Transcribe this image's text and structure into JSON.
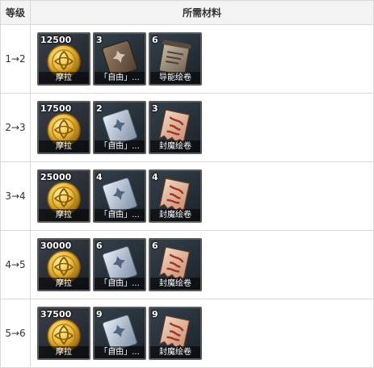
{
  "header": {
    "level": "等级",
    "materials": "所需材料"
  },
  "rows": [
    {
      "level": "1→2",
      "items": [
        {
          "icon": "mora-coin-icon",
          "qty": "12500",
          "name": "摩拉"
        },
        {
          "icon": "freedom-book-icon",
          "qty": "3",
          "name": "「自由」..."
        },
        {
          "icon": "guide-scroll-icon",
          "qty": "6",
          "name": "导能绘卷"
        }
      ]
    },
    {
      "level": "2→3",
      "items": [
        {
          "icon": "mora-coin-icon",
          "qty": "17500",
          "name": "摩拉"
        },
        {
          "icon": "freedom-book-icon",
          "qty": "2",
          "name": "「自由」..."
        },
        {
          "icon": "sealed-scroll-icon",
          "qty": "3",
          "name": "封魔绘卷"
        }
      ]
    },
    {
      "level": "3→4",
      "items": [
        {
          "icon": "mora-coin-icon",
          "qty": "25000",
          "name": "摩拉"
        },
        {
          "icon": "freedom-book-icon",
          "qty": "4",
          "name": "「自由」..."
        },
        {
          "icon": "sealed-scroll-icon",
          "qty": "4",
          "name": "封魔绘卷"
        }
      ]
    },
    {
      "level": "4→5",
      "items": [
        {
          "icon": "mora-coin-icon",
          "qty": "30000",
          "name": "摩拉"
        },
        {
          "icon": "freedom-book-icon",
          "qty": "6",
          "name": "「自由」..."
        },
        {
          "icon": "sealed-scroll-icon",
          "qty": "6",
          "name": "封魔绘卷"
        }
      ]
    },
    {
      "level": "5→6",
      "items": [
        {
          "icon": "mora-coin-icon",
          "qty": "37500",
          "name": "摩拉"
        },
        {
          "icon": "freedom-book-icon",
          "qty": "9",
          "name": "「自由」..."
        },
        {
          "icon": "sealed-scroll-icon",
          "qty": "9",
          "name": "封魔绘卷"
        }
      ]
    }
  ]
}
